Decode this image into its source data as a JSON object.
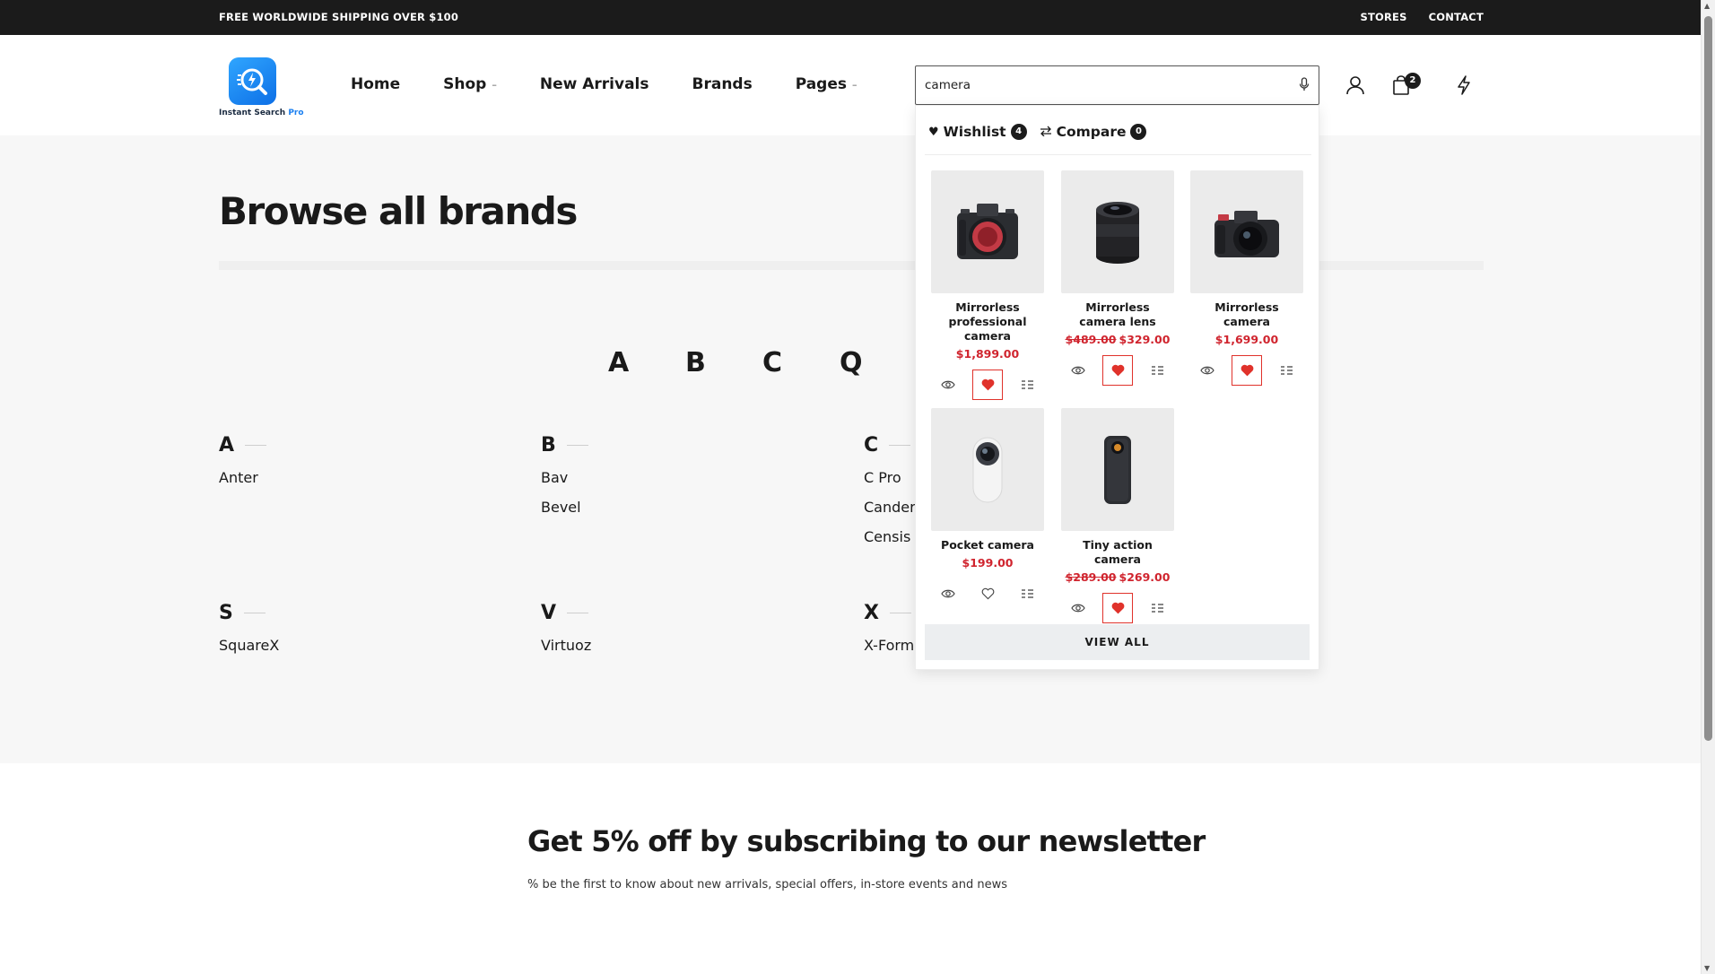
{
  "topbar": {
    "shipping": "FREE WORLDWIDE SHIPPING OVER $100",
    "stores": "STORES",
    "contact": "CONTACT"
  },
  "logo": {
    "text": "Instant Search",
    "suffix": "Pro"
  },
  "nav": {
    "home": "Home",
    "shop": "Shop",
    "new_arrivals": "New Arrivals",
    "brands": "Brands",
    "pages": "Pages",
    "caret": "–"
  },
  "search": {
    "value": "camera"
  },
  "header": {
    "cart_count": "2"
  },
  "page": {
    "title": "Browse all brands"
  },
  "letters": [
    "A",
    "B",
    "C",
    "Q"
  ],
  "brand_groups": [
    {
      "letter": "A",
      "items": [
        "Anter"
      ]
    },
    {
      "letter": "B",
      "items": [
        "Bav",
        "Bevel"
      ]
    },
    {
      "letter": "C",
      "items": [
        "C Pro",
        "Candera",
        "Censis"
      ]
    },
    {
      "letter": "S",
      "items": [
        "SquareX"
      ]
    },
    {
      "letter": "V",
      "items": [
        "Virtuoz"
      ]
    },
    {
      "letter": "X",
      "items": [
        "X-Form"
      ]
    }
  ],
  "newsletter": {
    "title": "Get 5% off by subscribing to our newsletter",
    "subtitle": "% be the first to know about new arrivals, special offers, in-store events and news"
  },
  "dropdown": {
    "wishlist_label": "Wishlist",
    "wishlist_count": "4",
    "compare_label": "Compare",
    "compare_count": "0",
    "view_all": "VIEW ALL",
    "products": [
      {
        "name": "Mirrorless professional camera",
        "price": "$1,899.00",
        "old_price": "",
        "wishlisted": true,
        "icon": "camera-body-icon"
      },
      {
        "name": "Mirrorless camera lens",
        "price": "$329.00",
        "old_price": "$489.00",
        "wishlisted": true,
        "icon": "camera-lens-icon"
      },
      {
        "name": "Mirrorless camera",
        "price": "$1,699.00",
        "old_price": "",
        "wishlisted": true,
        "icon": "camera-icon"
      },
      {
        "name": "Pocket camera",
        "price": "$199.00",
        "old_price": "",
        "wishlisted": false,
        "icon": "pocket-camera-icon"
      },
      {
        "name": "Tiny action camera",
        "price": "$269.00",
        "old_price": "$289.00",
        "wishlisted": true,
        "icon": "action-camera-icon"
      }
    ]
  },
  "colors": {
    "accent_red": "#d0242e",
    "heart_red": "#e0322b",
    "topbar_bg": "#1b1b1b",
    "page_bg": "#f7f7f7"
  }
}
